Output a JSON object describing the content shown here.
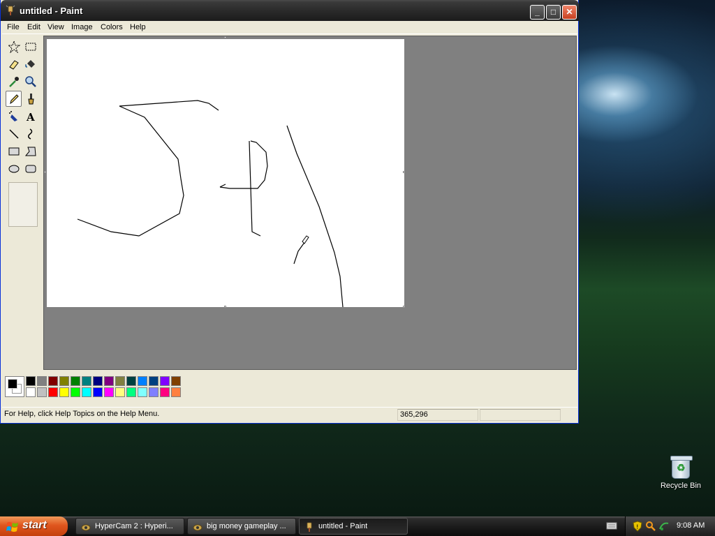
{
  "window": {
    "title": "untitled - Paint",
    "minimize_glyph": "_",
    "maximize_glyph": "□",
    "close_glyph": "✕"
  },
  "menu": [
    "File",
    "Edit",
    "View",
    "Image",
    "Colors",
    "Help"
  ],
  "tools": [
    {
      "name": "free-form-select",
      "selected": false
    },
    {
      "name": "rect-select",
      "selected": false
    },
    {
      "name": "eraser",
      "selected": false
    },
    {
      "name": "fill-with-color",
      "selected": false
    },
    {
      "name": "pick-color",
      "selected": false
    },
    {
      "name": "magnifier",
      "selected": false
    },
    {
      "name": "pencil",
      "selected": true
    },
    {
      "name": "brush",
      "selected": false
    },
    {
      "name": "airbrush",
      "selected": false
    },
    {
      "name": "text",
      "selected": false
    },
    {
      "name": "line",
      "selected": false
    },
    {
      "name": "curve",
      "selected": false
    },
    {
      "name": "rectangle",
      "selected": false
    },
    {
      "name": "polygon",
      "selected": false
    },
    {
      "name": "ellipse",
      "selected": false
    },
    {
      "name": "rounded-rectangle",
      "selected": false
    }
  ],
  "palette": {
    "foreground": "#000000",
    "background": "#FFFFFF",
    "row1": [
      "#000000",
      "#808080",
      "#800000",
      "#808000",
      "#008000",
      "#008080",
      "#000080",
      "#800080",
      "#808040",
      "#004040",
      "#0080FF",
      "#004080",
      "#8000FF",
      "#804000"
    ],
    "row2": [
      "#FFFFFF",
      "#C0C0C0",
      "#FF0000",
      "#FFFF00",
      "#00FF00",
      "#00FFFF",
      "#0000FF",
      "#FF00FF",
      "#FFFF80",
      "#00FF80",
      "#80FFFF",
      "#8080FF",
      "#FF0080",
      "#FF8040"
    ]
  },
  "status": {
    "help_text": "For Help, click Help Topics on the Help Menu.",
    "coordinates": "365,296"
  },
  "desktop": {
    "recycle_bin_label": "Recycle Bin"
  },
  "taskbar": {
    "start_label": "start",
    "tasks": [
      {
        "label": "HyperCam 2 : Hyperi...",
        "active": false
      },
      {
        "label": "big money gameplay ...",
        "active": false
      },
      {
        "label": "untitled - Paint",
        "active": true
      }
    ],
    "clock": "9:08 AM"
  }
}
